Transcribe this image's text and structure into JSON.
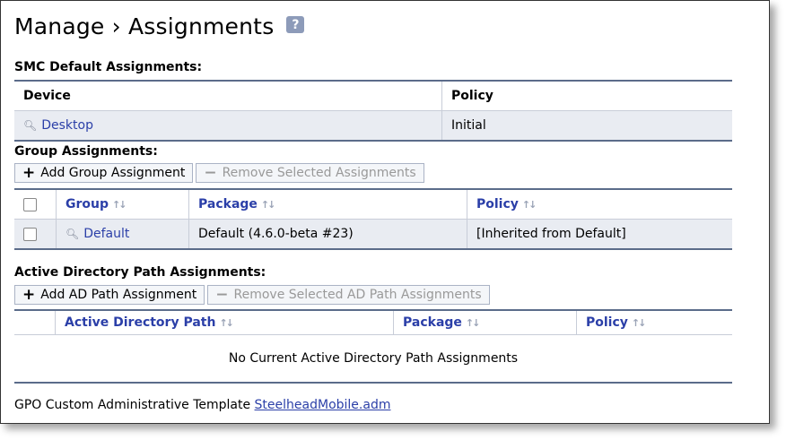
{
  "page": {
    "title": "Manage › Assignments",
    "help_label": "?"
  },
  "smc": {
    "heading": "SMC Default Assignments:",
    "columns": [
      "Device",
      "Policy"
    ],
    "row": {
      "device": "Desktop",
      "policy": "Initial"
    }
  },
  "group": {
    "heading": "Group Assignments:",
    "add_label": "Add Group Assignment",
    "remove_label": "Remove Selected Assignments",
    "columns": [
      "Group",
      "Package",
      "Policy"
    ],
    "row": {
      "group": "Default",
      "package": "Default (4.6.0-beta #23)",
      "policy": "[Inherited from Default]"
    }
  },
  "ad": {
    "heading": "Active Directory Path Assignments:",
    "add_label": "Add AD Path Assignment",
    "remove_label": "Remove Selected AD Path Assignments",
    "columns": [
      "Active Directory Path",
      "Package",
      "Policy"
    ],
    "empty_text": "No Current Active Directory Path Assignments"
  },
  "footer": {
    "text": "GPO Custom Administrative Template",
    "link": "SteelheadMobile.adm"
  },
  "icons": {
    "help": "help-icon",
    "view": "magnifier-icon",
    "sort": "sort-icon",
    "add": "plus-icon",
    "remove": "minus-icon"
  }
}
